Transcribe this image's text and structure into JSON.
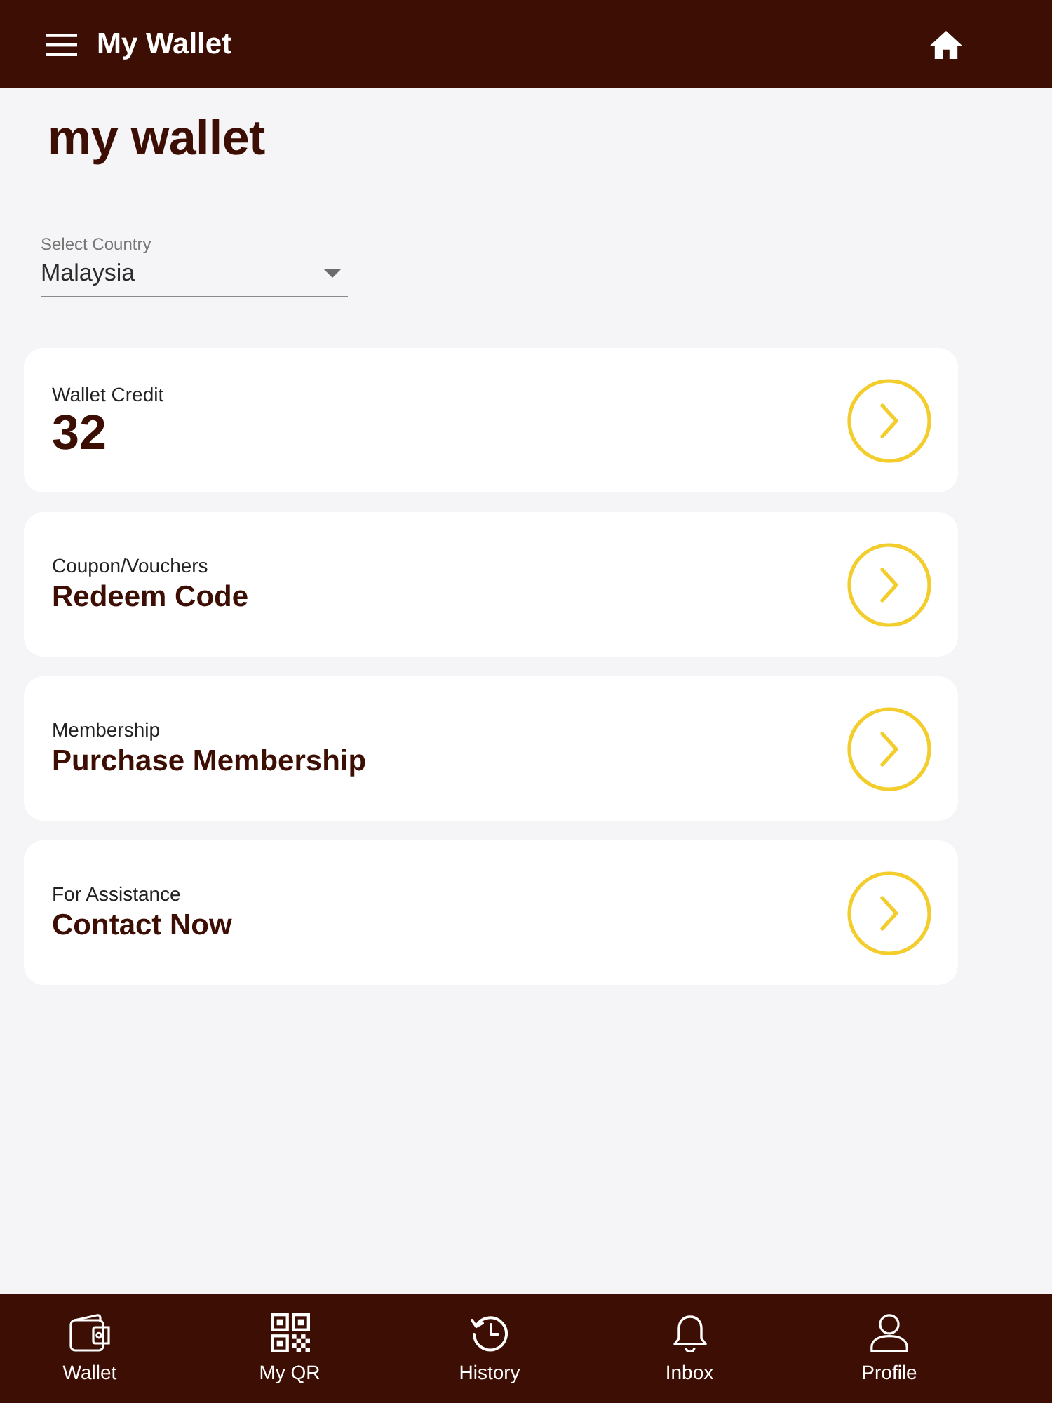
{
  "header": {
    "title": "My Wallet"
  },
  "page_title": "my wallet",
  "country_select": {
    "label": "Select Country",
    "value": "Malaysia"
  },
  "cards": [
    {
      "kind": "amount",
      "label": "Wallet Credit",
      "value": "32"
    },
    {
      "kind": "link",
      "label": "Coupon/Vouchers",
      "value": "Redeem Code"
    },
    {
      "kind": "link",
      "label": "Membership",
      "value": "Purchase Membership"
    },
    {
      "kind": "link",
      "label": "For Assistance",
      "value": "Contact Now"
    }
  ],
  "bottom_nav": [
    {
      "kind": "wallet",
      "label": "Wallet"
    },
    {
      "kind": "qr",
      "label": "My QR"
    },
    {
      "kind": "history",
      "label": "History"
    },
    {
      "kind": "inbox",
      "label": "Inbox"
    },
    {
      "kind": "profile",
      "label": "Profile"
    }
  ]
}
